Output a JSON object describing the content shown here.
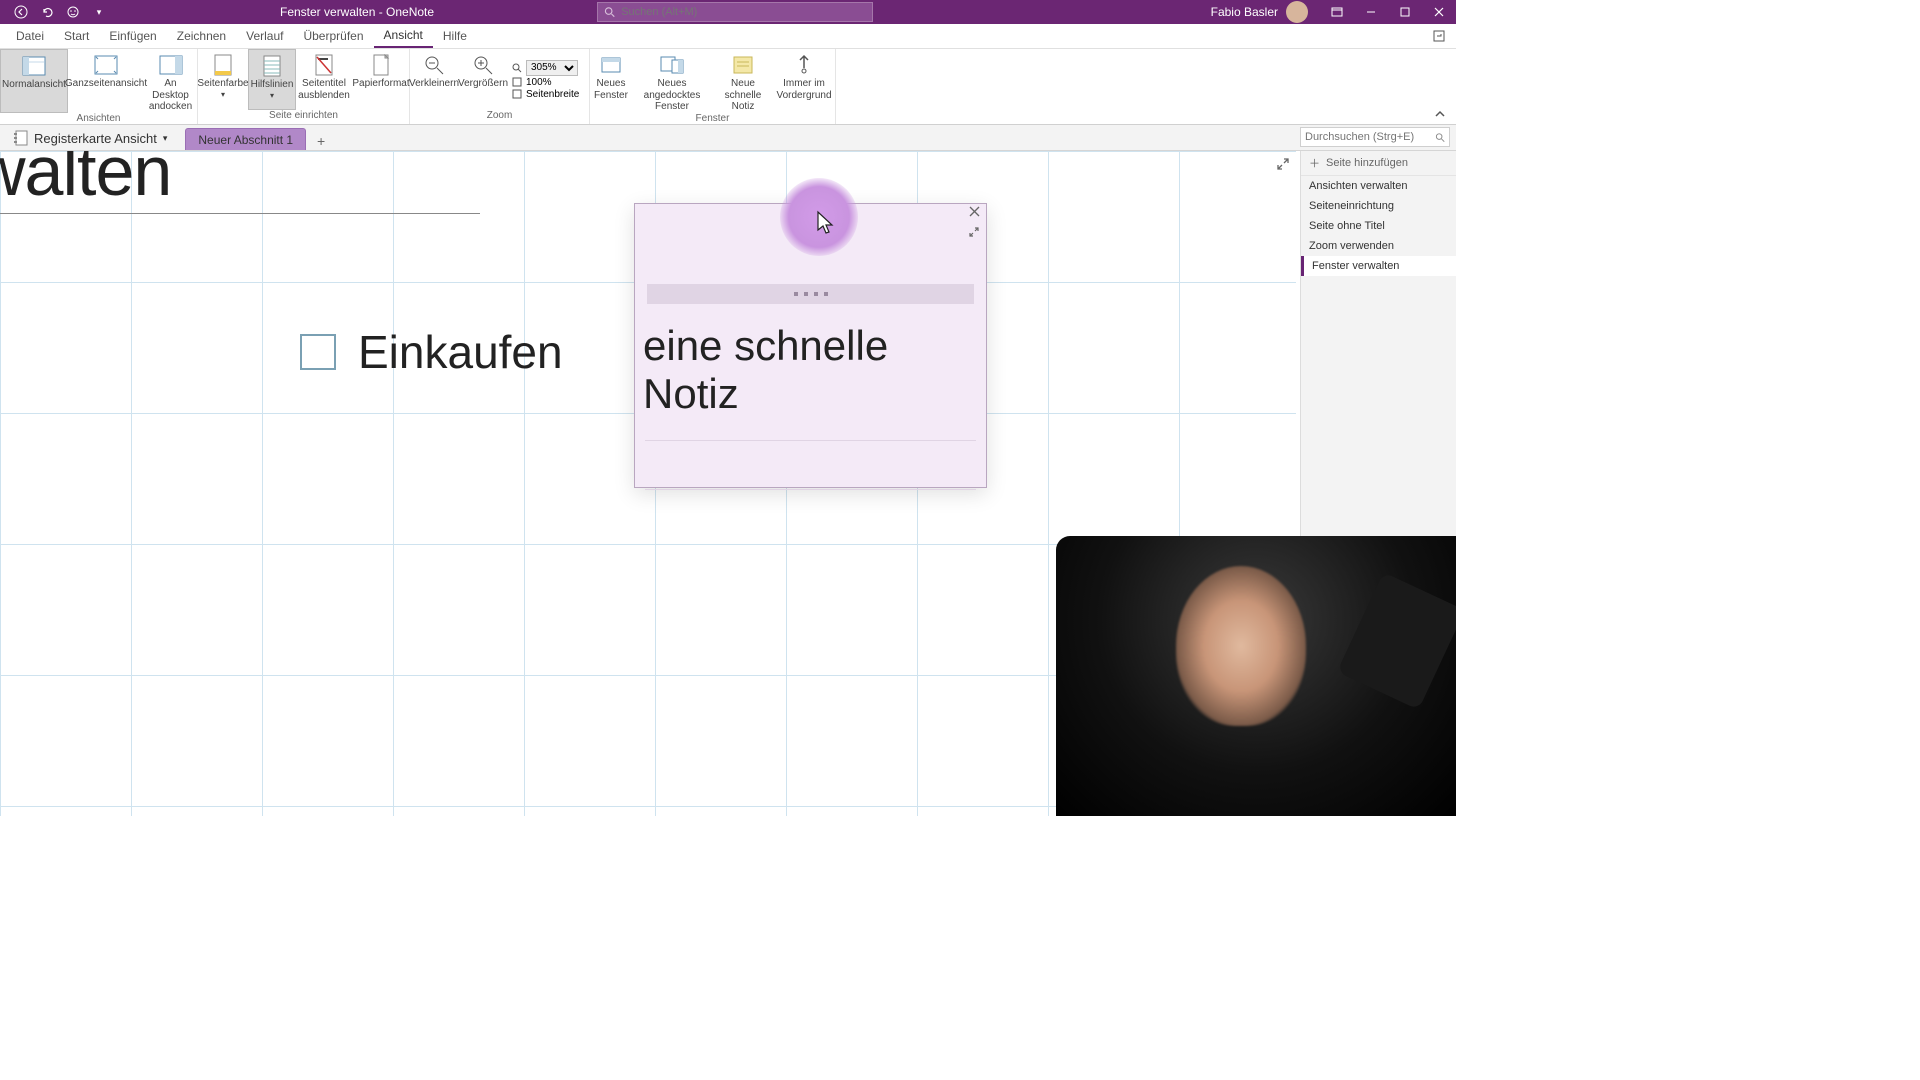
{
  "titlebar": {
    "title": "Fenster verwalten  -  OneNote",
    "search_placeholder": "Suchen (Alt+M)",
    "user_name": "Fabio Basler"
  },
  "menu": {
    "items": [
      "Datei",
      "Start",
      "Einfügen",
      "Zeichnen",
      "Verlauf",
      "Überprüfen",
      "Ansicht",
      "Hilfe"
    ],
    "active": "Ansicht"
  },
  "ribbon": {
    "groups": {
      "ansichten": {
        "label": "Ansichten",
        "normal": "Normalansicht",
        "ganz": "Ganzseitenansicht",
        "dock": "An Desktop andocken"
      },
      "seite": {
        "label": "Seite einrichten",
        "farbe": "Seitenfarbe",
        "hilfs": "Hilfslinien",
        "titel": "Seitentitel ausblenden",
        "papier": "Papierformat"
      },
      "zoom": {
        "label": "Zoom",
        "verkleinern": "Verkleinern",
        "vergroessern": "Vergrößern",
        "value": "305%",
        "hundred": "100%",
        "breite": "Seitenbreite"
      },
      "fenster": {
        "label": "Fenster",
        "neu": "Neues Fenster",
        "angedockt": "Neues angedocktes Fenster",
        "schnelle": "Neue schnelle Notiz",
        "immer": "Immer im Vordergrund"
      }
    }
  },
  "sectionbar": {
    "notebook": "Registerkarte Ansicht",
    "section_tab": "Neuer Abschnitt 1",
    "search_placeholder": "Durchsuchen (Strg+E)"
  },
  "canvas": {
    "page_title_fragment": "r verwalten",
    "todo_text": "Einkaufen"
  },
  "quicknote": {
    "text": "eine schnelle Notiz"
  },
  "pagepane": {
    "add_page": "Seite hinzufügen",
    "items": [
      "Ansichten verwalten",
      "Seiteneinrichtung",
      "Seite ohne Titel",
      "Zoom verwenden",
      "Fenster verwalten"
    ],
    "active": "Fenster verwalten"
  }
}
